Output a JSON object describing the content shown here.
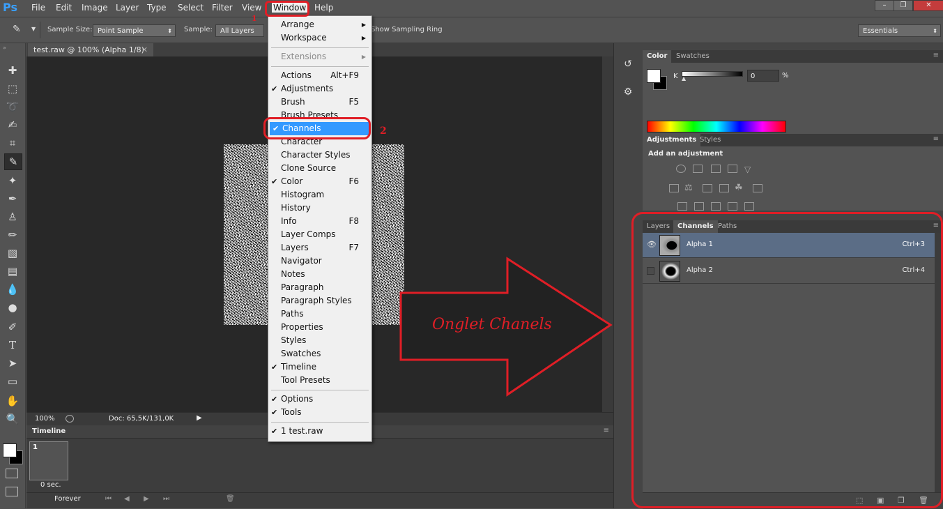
{
  "app": {
    "logo": "Ps"
  },
  "menubar": {
    "items": [
      "File",
      "Edit",
      "Image",
      "Layer",
      "Type",
      "Select",
      "Filter",
      "View",
      "Window",
      "Help"
    ],
    "window_controls": [
      "–",
      "❐",
      "✕"
    ]
  },
  "options_bar": {
    "sample_size_label": "Sample Size:",
    "sample_size_value": "Point Sample",
    "sample_label": "Sample:",
    "sample_value": "All Layers",
    "show_sampling_ring": "Show Sampling Ring",
    "workspace_value": "Essentials"
  },
  "document": {
    "tab_title": "test.raw @ 100% (Alpha 1/8)",
    "zoom": "100%",
    "doc_info": "Doc: 65,5K/131,0K"
  },
  "timeline": {
    "title": "Timeline",
    "frame_number": "1",
    "frame_delay": "0 sec.",
    "loop_value": "Forever"
  },
  "color_panel": {
    "tabs": [
      "Color",
      "Swatches"
    ],
    "channel_label": "K",
    "value": "0",
    "unit": "%"
  },
  "adjustments_panel": {
    "tabs": [
      "Adjustments",
      "Styles"
    ],
    "heading": "Add an adjustment"
  },
  "layers_panel": {
    "tabs": [
      "Layers",
      "Channels",
      "Paths"
    ],
    "channels": [
      {
        "name": "Alpha 1",
        "shortcut": "Ctrl+3",
        "visible": true
      },
      {
        "name": "Alpha 2",
        "shortcut": "Ctrl+4",
        "visible": false
      }
    ]
  },
  "window_menu": {
    "items": [
      {
        "label": "Arrange",
        "submenu": true
      },
      {
        "label": "Workspace",
        "submenu": true
      },
      {
        "sep": true
      },
      {
        "label": "Extensions",
        "submenu": true,
        "disabled": true
      },
      {
        "sep": true
      },
      {
        "label": "Actions",
        "shortcut": "Alt+F9"
      },
      {
        "label": "Adjustments",
        "checked": true
      },
      {
        "label": "Brush",
        "shortcut": "F5"
      },
      {
        "label": "Brush Presets"
      },
      {
        "label": "Channels",
        "checked": true,
        "highlighted": true
      },
      {
        "label": "Character"
      },
      {
        "label": "Character Styles"
      },
      {
        "label": "Clone Source"
      },
      {
        "label": "Color",
        "checked": true,
        "shortcut": "F6"
      },
      {
        "label": "Histogram"
      },
      {
        "label": "History"
      },
      {
        "label": "Info",
        "shortcut": "F8"
      },
      {
        "label": "Layer Comps"
      },
      {
        "label": "Layers",
        "shortcut": "F7"
      },
      {
        "label": "Navigator"
      },
      {
        "label": "Notes"
      },
      {
        "label": "Paragraph"
      },
      {
        "label": "Paragraph Styles"
      },
      {
        "label": "Paths"
      },
      {
        "label": "Properties"
      },
      {
        "label": "Styles"
      },
      {
        "label": "Swatches"
      },
      {
        "label": "Timeline",
        "checked": true
      },
      {
        "label": "Tool Presets"
      },
      {
        "sep": true
      },
      {
        "label": "Options",
        "checked": true
      },
      {
        "label": "Tools",
        "checked": true
      },
      {
        "sep": true
      },
      {
        "label": "1 test.raw",
        "checked": true
      }
    ]
  },
  "annotations": {
    "step1": "1",
    "step2": "2",
    "arrow_text": "Onglet Chanels",
    "color": "#e01e26"
  },
  "icons": [
    "eyedropper-icon",
    "move-icon",
    "marquee-icon",
    "lasso-icon",
    "quick-select-icon",
    "crop-icon",
    "healing-icon",
    "brush-icon",
    "stamp-icon",
    "history-brush-icon",
    "eraser-icon",
    "gradient-icon",
    "blur-icon",
    "dodge-icon",
    "pen-icon",
    "type-icon",
    "path-select-icon",
    "shape-icon",
    "hand-icon",
    "zoom-icon",
    "eye-icon"
  ]
}
